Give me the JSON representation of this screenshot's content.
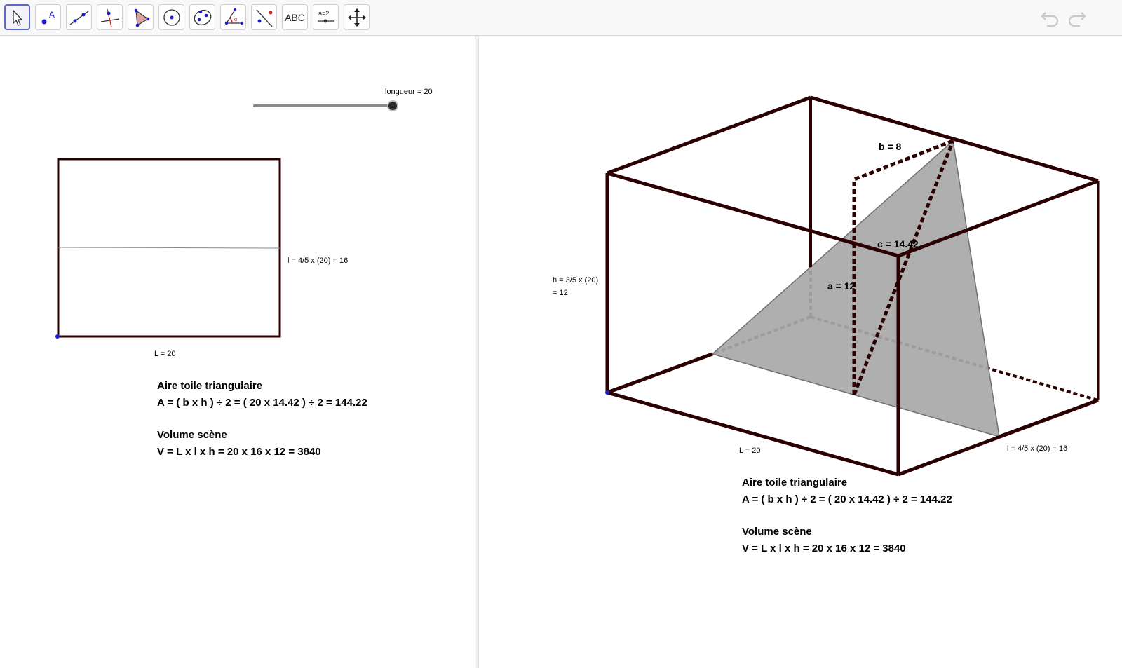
{
  "toolbar": {
    "tools": [
      {
        "name": "move-tool",
        "icon": "cursor-arrow-icon"
      },
      {
        "name": "point-tool",
        "icon": "point-icon",
        "glyph": "A"
      },
      {
        "name": "line-tool",
        "icon": "line-icon"
      },
      {
        "name": "perpendicular-tool",
        "icon": "perpendicular-icon"
      },
      {
        "name": "polygon-tool",
        "icon": "polygon-icon"
      },
      {
        "name": "circle-tool",
        "icon": "circle-icon"
      },
      {
        "name": "ellipse-tool",
        "icon": "ellipse-icon"
      },
      {
        "name": "angle-tool",
        "icon": "angle-icon"
      },
      {
        "name": "reflect-tool",
        "icon": "reflect-icon"
      },
      {
        "name": "text-tool",
        "icon": "text-icon",
        "glyph": "ABC"
      },
      {
        "name": "slider-tool",
        "icon": "slider-icon",
        "glyph": "a=2"
      },
      {
        "name": "move-view-tool",
        "icon": "move-graphics-view-icon"
      }
    ],
    "undo_icon": "undo-icon",
    "redo_icon": "redo-icon"
  },
  "left_view": {
    "slider_label": "longueur = 20",
    "slider_value": 1.0,
    "width_label": "l = 4/5 x (20) = 16",
    "length_label": "L = 20",
    "area_title": "Aire toile triangulaire",
    "area_formula": "A = ( b x h ) ÷ 2 = ( 20 x 14.42 ) ÷ 2 = 144.22",
    "volume_title": "Volume scène",
    "volume_formula": "V = L x l x h = 20 x 16 x 12 = 3840"
  },
  "right_view": {
    "height_label_line1": "h = 3/5 x (20)",
    "height_label_line2": "= 12",
    "b_label": "b = 8",
    "c_label": "c = 14.42",
    "a_label": "a = 12",
    "length_label": "L = 20",
    "width_label": "l = 4/5 x (20) = 16",
    "area_title": "Aire toile triangulaire",
    "area_formula": "A = ( b x h ) ÷ 2 = ( 20 x 14.42 ) ÷ 2 = 144.22",
    "volume_title": "Volume scène",
    "volume_formula": "V = L x l x h = 20 x 16 x 12 = 3840"
  },
  "colors": {
    "edge": "#2a0000",
    "triangle_fill": "#a8a8a8",
    "accent": "#5a69c4",
    "point": "#1c1ccc"
  }
}
